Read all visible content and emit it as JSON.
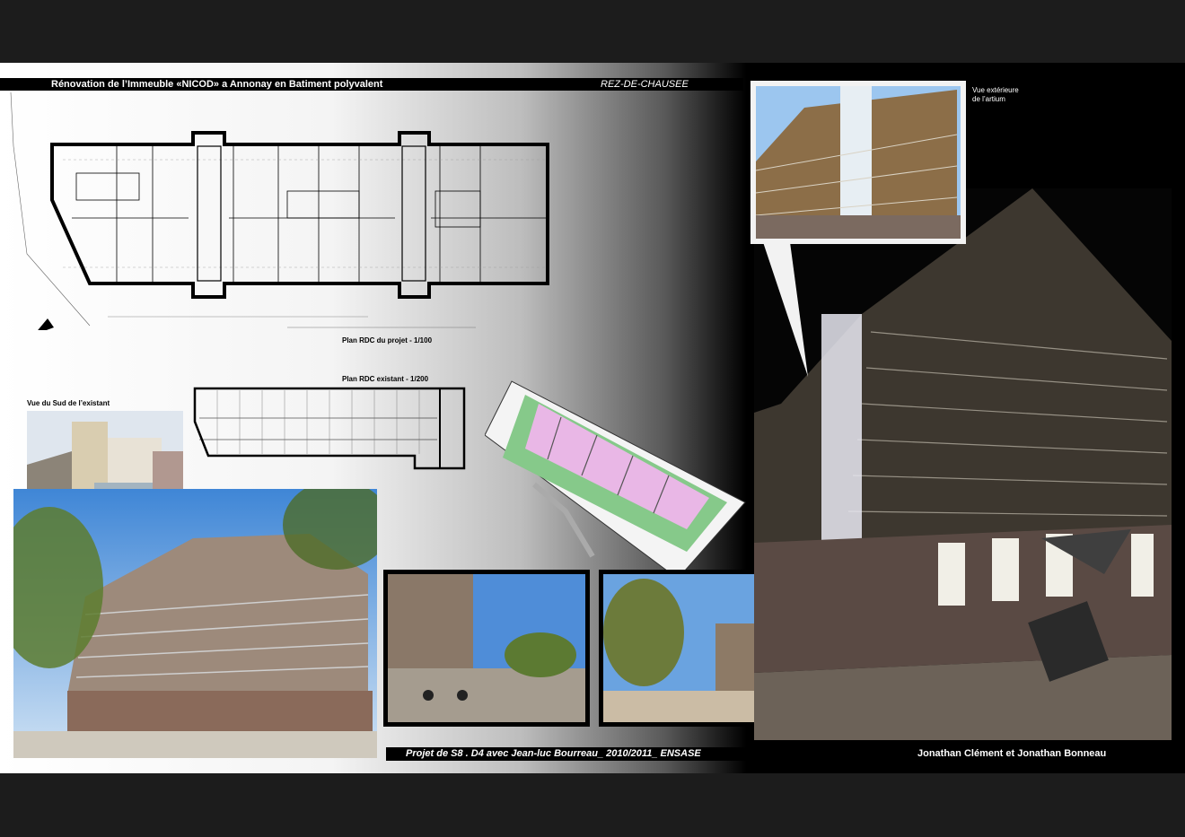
{
  "header": {
    "title": "Rénovation de l’Immeuble «NICOD» a Annonay en Batiment polyvalent",
    "level": "REZ-DE-CHAUSEE"
  },
  "captions": {
    "plan_project": "Plan RDC du projet - 1/100",
    "plan_existing": "Plan RDC existant - 1/200",
    "south_view": "Vue du Sud de l’existant",
    "atrium_line1": "Vue extérieure",
    "atrium_line2": "de l’artium"
  },
  "footer": {
    "credit": "Projet de S8 . D4 avec Jean-luc Bourreau_ 2010/2011_ ENSASE",
    "authors": "Jonathan Clément  et  Jonathan Bonneau"
  },
  "colors": {
    "frame": "#1c1c1c",
    "bar": "#000000",
    "sky": "#6fa8e0",
    "brick": "#8a6a5a",
    "model_pink": "#e9b7e6",
    "model_green": "#86c98a"
  }
}
